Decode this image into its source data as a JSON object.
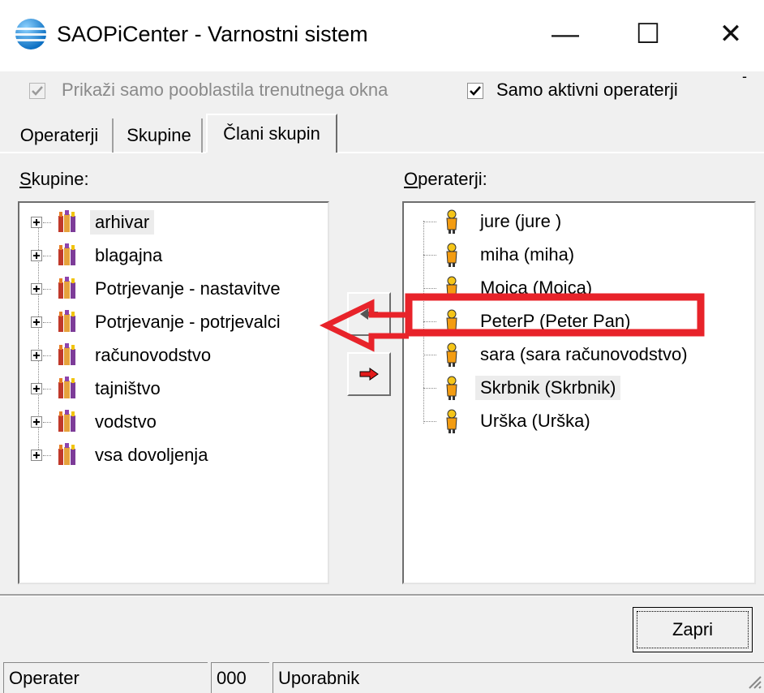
{
  "window": {
    "title": "SAOPiCenter - Varnostni sistem",
    "buttons": {
      "minimize": "—",
      "maximize": "☐",
      "close": "✕"
    },
    "logo_icon": "saop-globe-icon"
  },
  "filters": {
    "show_only_current_window": {
      "label": "Prikaži samo pooblastila trenutnega okna",
      "checked": true,
      "enabled": false
    },
    "only_active_operators": {
      "label": "Samo aktivni operaterji",
      "checked": true,
      "enabled": true
    },
    "stray_mark": "-"
  },
  "tabs": [
    {
      "label": "Operaterji",
      "active": false
    },
    {
      "label": "Skupine",
      "active": false
    },
    {
      "label": "Člani skupin",
      "active": true
    }
  ],
  "groups_panel": {
    "label": "Skupine:",
    "items": [
      {
        "label": "arhivar",
        "selected": true
      },
      {
        "label": "blagajna",
        "selected": false
      },
      {
        "label": "Potrjevanje - nastavitve",
        "selected": false
      },
      {
        "label": "Potrjevanje - potrjevalci",
        "selected": false
      },
      {
        "label": "računovodstvo",
        "selected": false
      },
      {
        "label": "tajništvo",
        "selected": false
      },
      {
        "label": "vodstvo",
        "selected": false
      },
      {
        "label": "vsa dovoljenja",
        "selected": false
      }
    ]
  },
  "operators_panel": {
    "label": "Operaterji:",
    "items": [
      {
        "label": "jure (jure )",
        "selected": false
      },
      {
        "label": "miha (miha)",
        "selected": false
      },
      {
        "label": "Mojca (Mojca)",
        "selected": false
      },
      {
        "label": "PeterP (Peter Pan)",
        "selected": false
      },
      {
        "label": "sara (sara računovodstvo)",
        "selected": false
      },
      {
        "label": "Skrbnik (Skrbnik)",
        "selected": true
      },
      {
        "label": "Urška (Urška)",
        "selected": false
      }
    ]
  },
  "actions": {
    "remove_icon": "arrow-left-icon",
    "add_icon": "arrow-right-red-icon",
    "close_button": "Zapri"
  },
  "annotation": {
    "color": "#e8232a"
  },
  "status_bar": {
    "field1": "Operater",
    "field2": "000",
    "field3": "Uporabnik"
  }
}
